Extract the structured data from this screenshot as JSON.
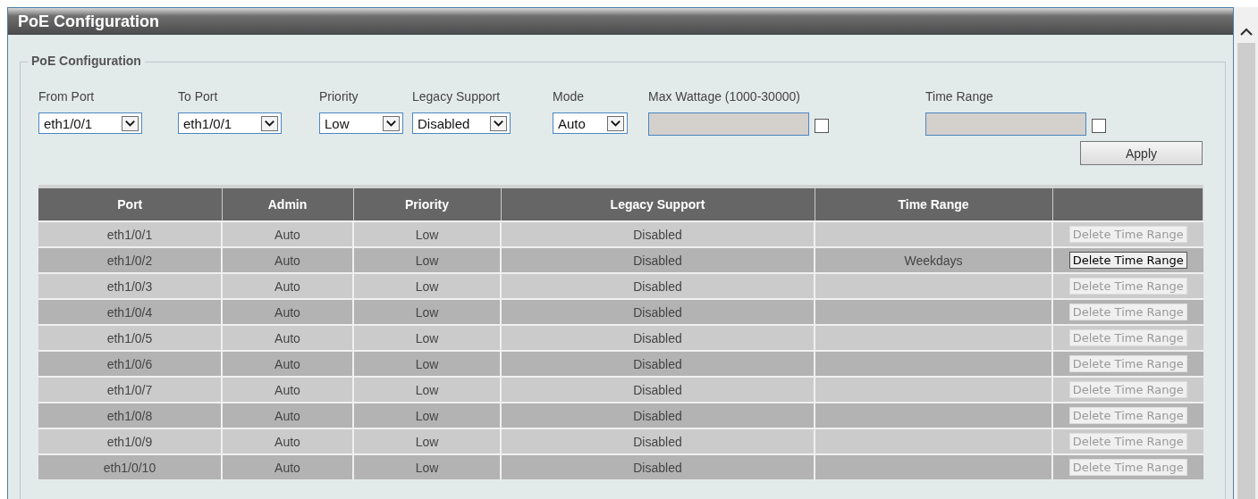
{
  "window": {
    "title": "PoE Configuration"
  },
  "form": {
    "legend": "PoE Configuration",
    "fields": [
      {
        "kind": "select",
        "label": "From Port",
        "value": "eth1/0/1"
      },
      {
        "kind": "select",
        "label": "To Port",
        "value": "eth1/0/1"
      },
      {
        "kind": "select",
        "label": "Priority",
        "value": "Low"
      },
      {
        "kind": "select",
        "label": "Legacy Support",
        "value": "Disabled"
      },
      {
        "kind": "select",
        "label": "Mode",
        "value": "Auto"
      },
      {
        "kind": "input",
        "label": "Max Wattage (1000-30000)",
        "disabled": true,
        "checked": false
      },
      {
        "kind": "input",
        "label": "Time Range",
        "disabled": true,
        "checked": false
      }
    ],
    "apply_button": "Apply"
  },
  "table": {
    "columns": [
      "Port",
      "Admin",
      "Priority",
      "Legacy Support",
      "Time Range"
    ],
    "rows": [
      {
        "port": "eth1/0/1",
        "admin": "Auto",
        "priority": "Low",
        "legacy": "Disabled",
        "action": "Delete Time Range",
        "disabled": true
      },
      {
        "port": "eth1/0/2",
        "admin": "Auto",
        "priority": "Low",
        "legacy": "Disabled",
        "time_range": "Weekdays",
        "action": "Delete Time Range",
        "disabled": false
      },
      {
        "port": "eth1/0/3",
        "admin": "Auto",
        "priority": "Low",
        "legacy": "Disabled",
        "action": "Delete Time Range",
        "disabled": true
      },
      {
        "port": "eth1/0/4",
        "admin": "Auto",
        "priority": "Low",
        "legacy": "Disabled",
        "action": "Delete Time Range",
        "disabled": true
      },
      {
        "port": "eth1/0/5",
        "admin": "Auto",
        "priority": "Low",
        "legacy": "Disabled",
        "action": "Delete Time Range",
        "disabled": true
      },
      {
        "port": "eth1/0/6",
        "admin": "Auto",
        "priority": "Low",
        "legacy": "Disabled",
        "action": "Delete Time Range",
        "disabled": true
      },
      {
        "port": "eth1/0/7",
        "admin": "Auto",
        "priority": "Low",
        "legacy": "Disabled",
        "action": "Delete Time Range",
        "disabled": true
      },
      {
        "port": "eth1/0/8",
        "admin": "Auto",
        "priority": "Low",
        "legacy": "Disabled",
        "action": "Delete Time Range",
        "disabled": true
      },
      {
        "port": "eth1/0/9",
        "admin": "Auto",
        "priority": "Low",
        "legacy": "Disabled",
        "action": "Delete Time Range",
        "disabled": true
      },
      {
        "port": "eth1/0/10",
        "admin": "Auto",
        "priority": "Low",
        "legacy": "Disabled",
        "action": "Delete Time Range",
        "disabled": true
      }
    ]
  }
}
